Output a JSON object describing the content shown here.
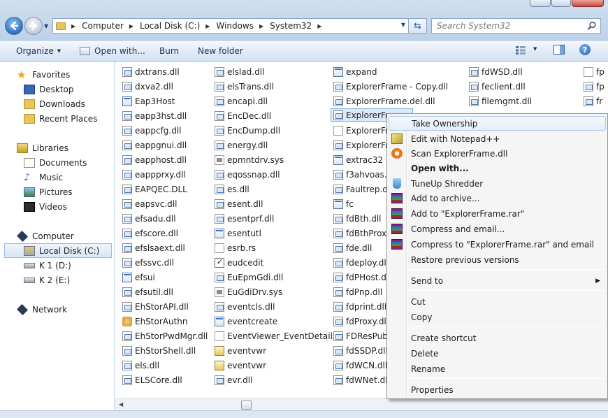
{
  "address": {
    "crumbs": [
      "Computer",
      "Local Disk (C:)",
      "Windows",
      "System32"
    ]
  },
  "search": {
    "placeholder": "Search System32"
  },
  "toolbar": {
    "organize": "Organize",
    "open_with": "Open with...",
    "burn": "Burn",
    "new_folder": "New folder"
  },
  "nav": {
    "favorites": "Favorites",
    "desktop": "Desktop",
    "downloads": "Downloads",
    "recent_places": "Recent Places",
    "libraries": "Libraries",
    "documents": "Documents",
    "music": "Music",
    "pictures": "Pictures",
    "videos": "Videos",
    "computer": "Computer",
    "local_disk": "Local Disk (C:)",
    "k1": "K 1 (D:)",
    "k2": "K 2 (E:)",
    "network": "Network"
  },
  "files": {
    "col1": [
      "dxtrans.dll",
      "dxva2.dll",
      "Eap3Host",
      "eapp3hst.dll",
      "eappcfg.dll",
      "eappgnui.dll",
      "eapphost.dll",
      "eappprxy.dll",
      "EAPQEC.DLL",
      "eapsvc.dll",
      "efsadu.dll",
      "efscore.dll",
      "efslsaext.dll",
      "efssvc.dll",
      "efsui",
      "efsutil.dll",
      "EhStorAPI.dll",
      "EhStorAuthn",
      "EhStorPwdMgr.dll",
      "EhStorShell.dll",
      "els.dll",
      "ELSCore.dll"
    ],
    "col2": [
      "elslad.dll",
      "elsTrans.dll",
      "encapi.dll",
      "EncDec.dll",
      "EncDump.dll",
      "energy.dll",
      "epmntdrv.sys",
      "eqossnap.dll",
      "es.dll",
      "esent.dll",
      "esentprf.dll",
      "esentutl",
      "esrb.rs",
      "eudcedit",
      "EuEpmGdi.dll",
      "EuGdiDrv.sys",
      "eventcls.dll",
      "eventcreate",
      "EventViewer_EventDetails",
      "eventvwr",
      "eventvwr",
      "evr.dll"
    ],
    "col3": [
      "expand",
      "ExplorerFrame - Copy.dll",
      "ExplorerFrame.del.dll",
      "ExplorerFra",
      "ExplorerFra",
      "ExplorerFra",
      "extrac32",
      "f3ahvoas.d",
      "Faultrep.dll",
      "fc",
      "fdBth.dll",
      "fdBthProxy",
      "fde.dll",
      "fdeploy.dll",
      "fdPHost.dll",
      "fdPnp.dll",
      "fdprint.dll",
      "fdProxy.dll",
      "FDResPub.c",
      "fdSSDP.dll",
      "fdWCN.dll",
      "fdWNet.dll"
    ],
    "col4": [
      "fdWSD.dll",
      "feclient.dll",
      "filemgmt.dll"
    ],
    "col5": [
      "fp",
      "fp",
      "fr"
    ]
  },
  "context_menu": {
    "take_ownership": "Take Ownership",
    "edit_notepad": "Edit with Notepad++",
    "scan": "Scan ExplorerFrame.dll",
    "open_with": "Open with...",
    "tuneup": "TuneUp Shredder",
    "add_archive": "Add to archive...",
    "add_rar": "Add to \"ExplorerFrame.rar\"",
    "compress_email": "Compress and email...",
    "compress_rar_email": "Compress to \"ExplorerFrame.rar\" and email",
    "restore": "Restore previous versions",
    "send_to": "Send to",
    "cut": "Cut",
    "copy": "Copy",
    "create_shortcut": "Create shortcut",
    "delete": "Delete",
    "rename": "Rename",
    "properties": "Properties"
  }
}
